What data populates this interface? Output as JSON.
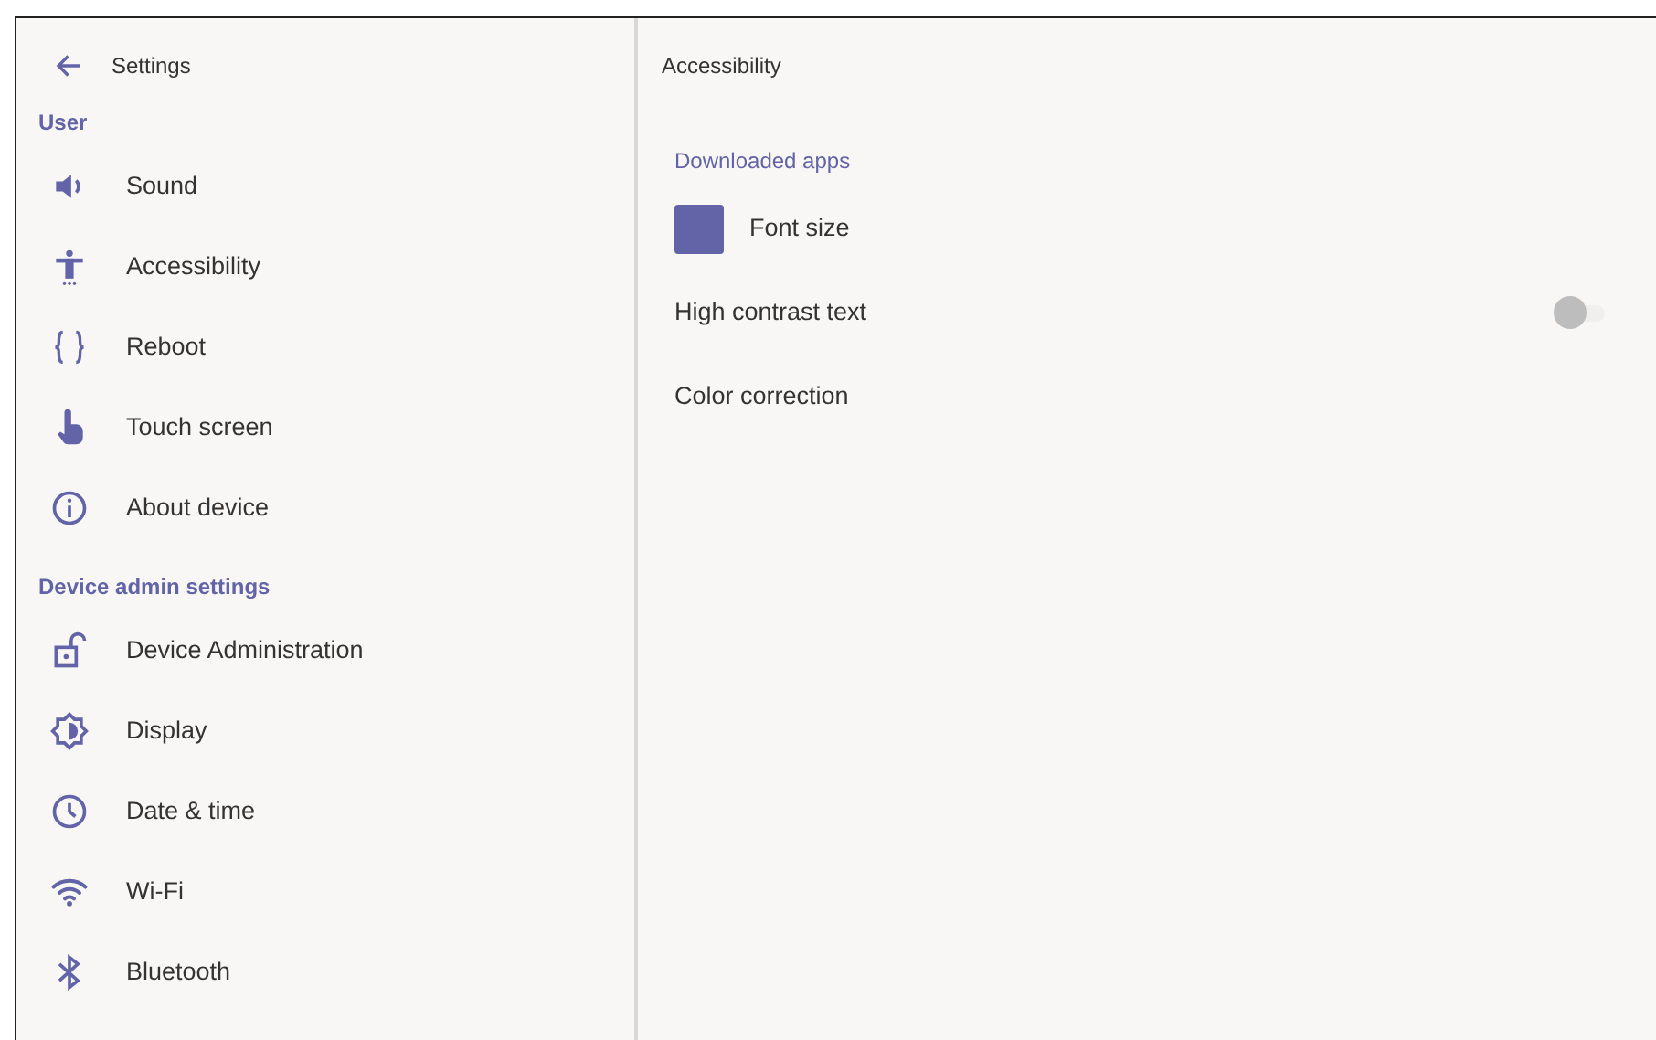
{
  "sidebar": {
    "back_title": "Settings",
    "sections": [
      {
        "header": "User",
        "items": [
          {
            "label": "Sound"
          },
          {
            "label": "Accessibility"
          },
          {
            "label": "Reboot"
          },
          {
            "label": "Touch screen"
          },
          {
            "label": "About device"
          }
        ]
      },
      {
        "header": "Device admin settings",
        "items": [
          {
            "label": "Device Administration"
          },
          {
            "label": "Display"
          },
          {
            "label": "Date & time"
          },
          {
            "label": "Wi-Fi"
          },
          {
            "label": "Bluetooth"
          }
        ]
      }
    ]
  },
  "detail": {
    "title": "Accessibility",
    "section_header": "Downloaded apps",
    "items": [
      {
        "kind": "app",
        "label": "Font size"
      },
      {
        "kind": "switch",
        "label": "High contrast text",
        "on": false
      },
      {
        "kind": "plain",
        "label": "Color correction"
      }
    ]
  }
}
